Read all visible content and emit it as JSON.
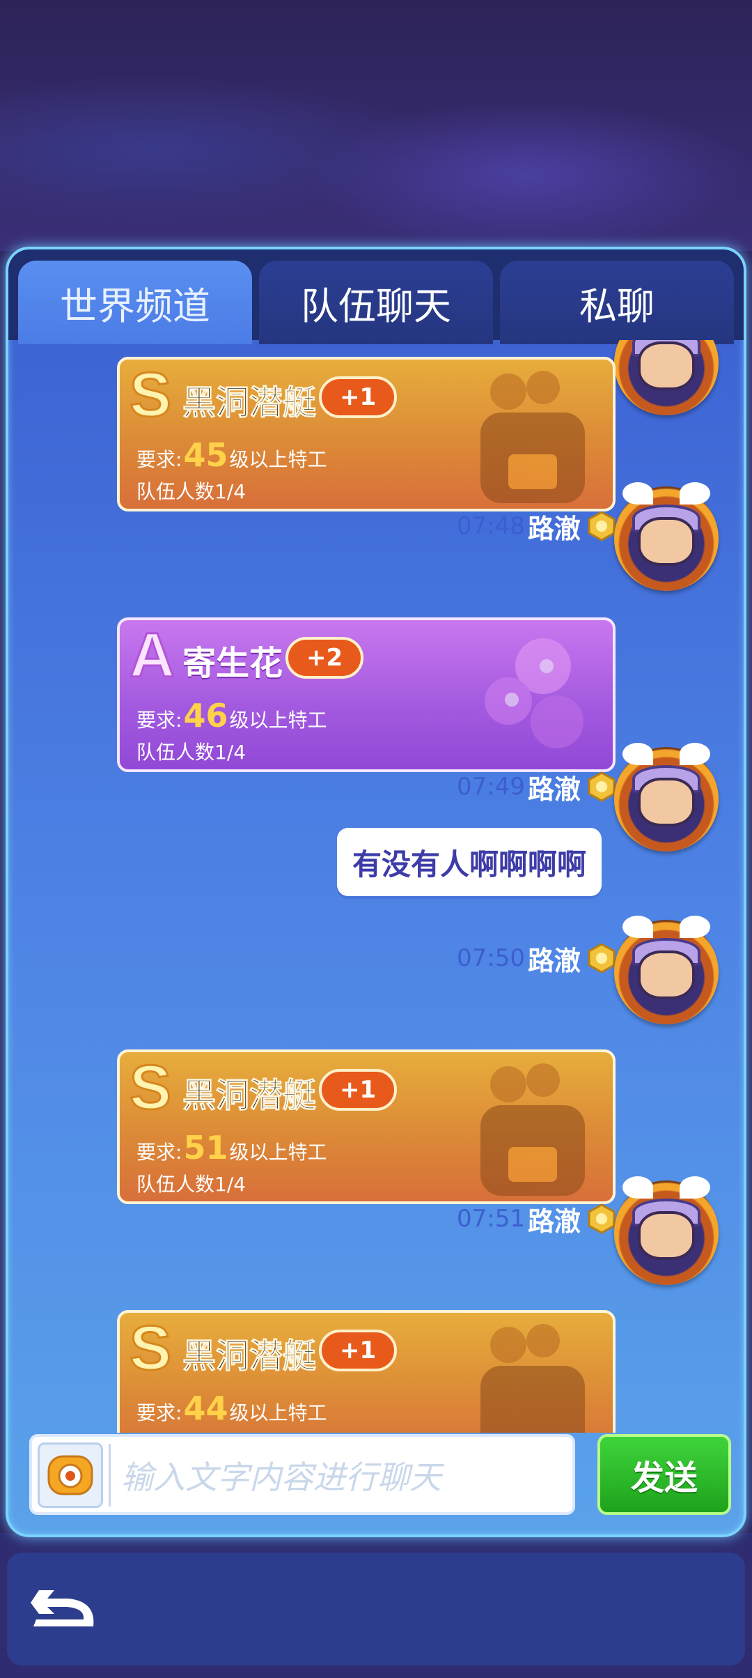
{
  "tabs": [
    {
      "label": "世界频道",
      "active": true
    },
    {
      "label": "队伍聊天",
      "active": false
    },
    {
      "label": "私聊",
      "active": false
    }
  ],
  "messages": [
    {
      "time": "",
      "user": "",
      "type": "team",
      "card": {
        "grade": "S",
        "name": "黑洞潜艇",
        "plus": "+1",
        "req_prefix": "要求:",
        "level": "45",
        "req_suffix": "级以上特工",
        "team": "队伍人数1/4"
      }
    },
    {
      "time": "07:48",
      "user": "路澈",
      "type": "team",
      "card": {
        "grade": "A",
        "name": "寄生花",
        "plus": "+2",
        "req_prefix": "要求:",
        "level": "46",
        "req_suffix": "级以上特工",
        "team": "队伍人数1/4"
      }
    },
    {
      "time": "07:49",
      "user": "路澈",
      "type": "text",
      "text": "有没有人啊啊啊啊"
    },
    {
      "time": "07:50",
      "user": "路澈",
      "type": "team",
      "card": {
        "grade": "S",
        "name": "黑洞潜艇",
        "plus": "+1",
        "req_prefix": "要求:",
        "level": "51",
        "req_suffix": "级以上特工",
        "team": "队伍人数1/4"
      }
    },
    {
      "time": "07:51",
      "user": "路澈",
      "type": "team",
      "card": {
        "grade": "S",
        "name": "黑洞潜艇",
        "plus": "+1",
        "req_prefix": "要求:",
        "level": "44",
        "req_suffix": "级以上特工",
        "team": ""
      }
    }
  ],
  "input": {
    "placeholder": "输入文字内容进行聊天",
    "value": ""
  },
  "send_label": "发送",
  "icons": {
    "emoji": "emoji-icon",
    "back": "back-arrow-icon",
    "rank": "rank-badge-icon"
  },
  "colors": {
    "panel": "#4f86e6",
    "card_s": "#dc8a37",
    "card_a": "#a55be0",
    "send": "#1ea21c"
  }
}
